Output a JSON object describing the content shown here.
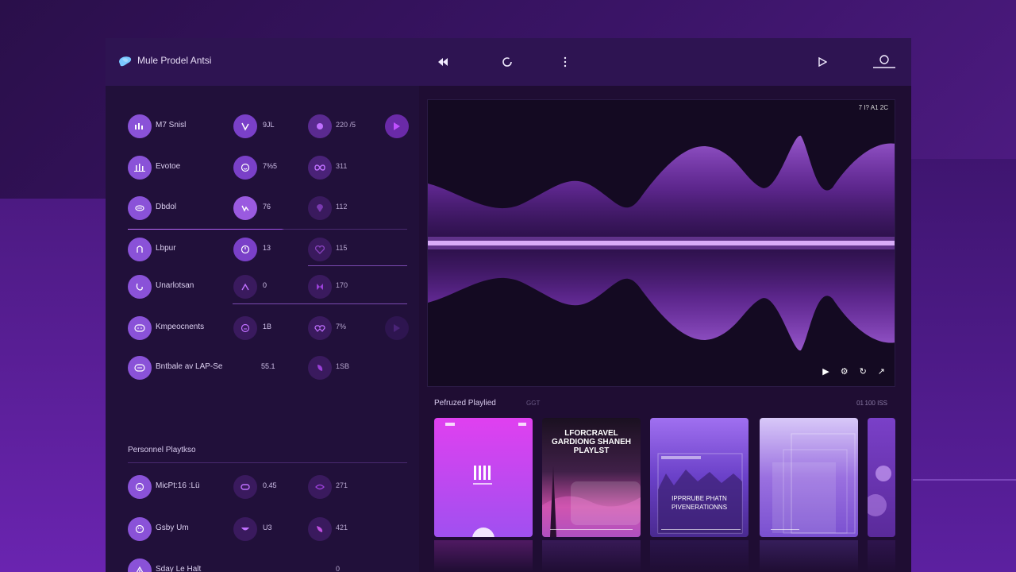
{
  "app": {
    "title": "Mule Prodel Antsi"
  },
  "topbar": {
    "icons": [
      "rewind-icon",
      "refresh-icon",
      "more-vertical-icon",
      "play-icon",
      "profile-icon"
    ]
  },
  "left_panel": {
    "rows": [
      {
        "label": "M7 Snisl",
        "icon": "equalizer-icon",
        "c2": "9JL",
        "c2_icon": "wave-icon",
        "c3": "220 /5",
        "c3_icon": "circle-dot-icon",
        "c4_icon": "play-icon"
      },
      {
        "label": "Evotoe",
        "icon": "bars-icon",
        "c2": "7%5",
        "c2_icon": "smile-icon",
        "c3": "311",
        "c3_icon": "infinity-icon"
      },
      {
        "label": "Dbdol",
        "icon": "shuffle-icon",
        "c2": "76",
        "c2_icon": "loop-icon",
        "c3": "112",
        "c3_icon": "pin-icon"
      },
      {
        "label": "Lbpur",
        "icon": "clip-icon",
        "c2": "13",
        "c2_icon": "clock-icon",
        "c3": "115",
        "c3_icon": "heart-icon"
      },
      {
        "label": "Unarlotsan",
        "icon": "wave-icon",
        "c2": "0",
        "c2_icon": "arrow-up-icon",
        "c3": "170",
        "c3_icon": "butterfly-icon"
      },
      {
        "label": "Kmpeocnents",
        "icon": "smile-icon",
        "c2": "1B",
        "c2_icon": "smile-icon",
        "c3": "7%",
        "c3_icon": "link-icon",
        "c4_icon": "play-icon"
      },
      {
        "label": "Bntbale av LAP-Se",
        "icon": "smile-icon",
        "c2": "55.1",
        "c3": "1SB",
        "c3_icon": "leaf-icon"
      }
    ],
    "section_title": "Personnel Playtkso",
    "playlist_rows": [
      {
        "label": "MicPt:16 :Lü",
        "icon": "smile-icon",
        "c2": "0.45",
        "c2_icon": "infinity-icon",
        "c3": "271",
        "c3_icon": "leaf-icon"
      },
      {
        "label": "Gsby Um",
        "icon": "smile-icon",
        "c2": "U3",
        "c2_icon": "smile-icon",
        "c3": "421",
        "c3_icon": "leaf-icon"
      },
      {
        "label": "Sday Le Halt",
        "icon": "smile-icon",
        "c3": "0"
      }
    ]
  },
  "visualizer": {
    "status": "7 I? A1 2C",
    "controls": [
      "play-icon",
      "settings-icon",
      "repeat-icon",
      "share-icon"
    ]
  },
  "featured": {
    "title": "Pefruzed Playlied",
    "meta": "GGT",
    "count_left": "01",
    "count_right": "100 ISS",
    "cards": [
      {
        "title": "",
        "subtitle": ""
      },
      {
        "title": "LFORCRAVEL GARDIONG SHANEH PLAYLST",
        "subtitle": ""
      },
      {
        "title": "",
        "subtitle": "IPPRRUBE PHATN PIVENERATIONNS"
      },
      {
        "title": "",
        "subtitle": ""
      },
      {
        "title": "",
        "subtitle": ""
      }
    ]
  },
  "colors": {
    "accent": "#8a52d8",
    "visualizer": "#a040f0",
    "card1": "#e040f0"
  }
}
